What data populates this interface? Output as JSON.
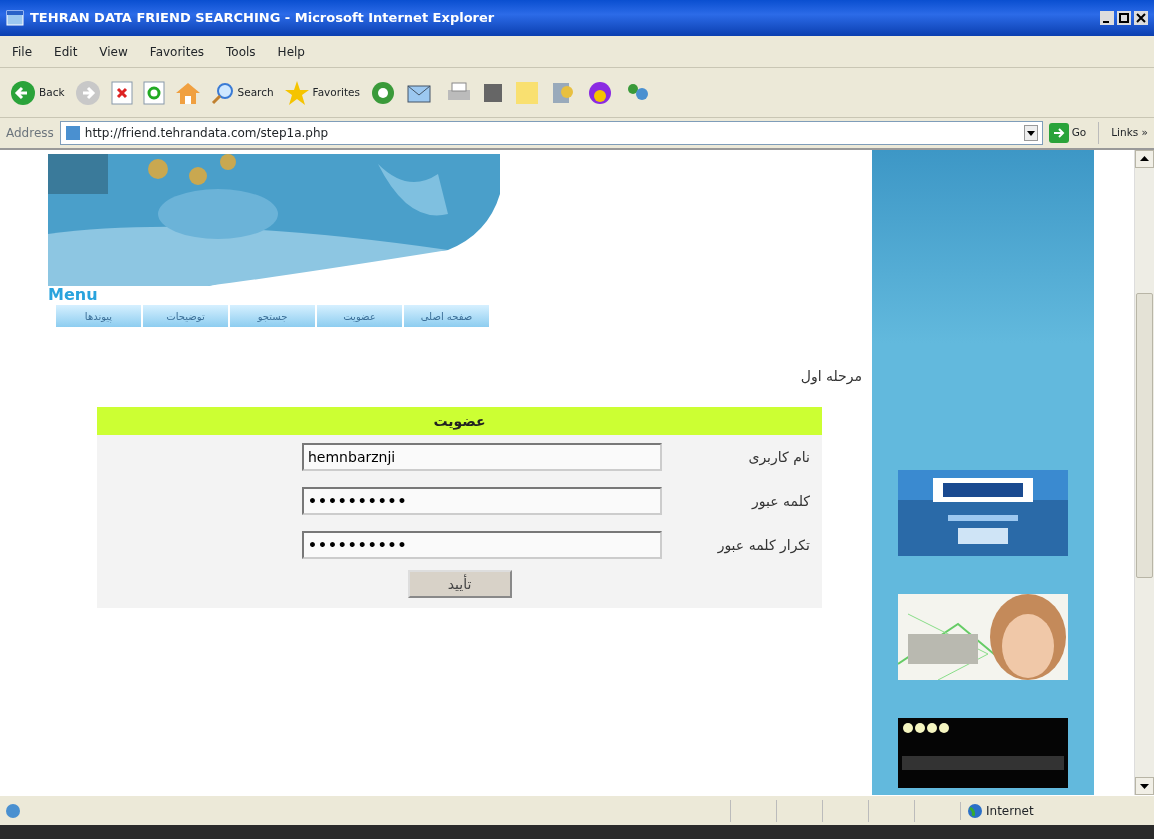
{
  "window": {
    "title": "TEHRAN DATA FRIEND SEARCHING - Microsoft Internet Explorer"
  },
  "menu_bar": {
    "file": "File",
    "edit": "Edit",
    "view": "View",
    "favorites": "Favorites",
    "tools": "Tools",
    "help": "Help"
  },
  "toolbar": {
    "back": "Back",
    "search": "Search",
    "favorites": "Favorites"
  },
  "address_bar": {
    "label": "Address",
    "url": "http://friend.tehrandata.com/step1a.php",
    "go": "Go",
    "links": "Links »"
  },
  "page": {
    "menu_title": "Menu",
    "menu_items": [
      "صفحه اصلی",
      "عضویت",
      "جستجو",
      "توضیحات",
      "پیوندها"
    ],
    "step": "مرحله اول",
    "form": {
      "title": "عضویت",
      "fields": [
        {
          "label": "نام کاربری",
          "kind": "text",
          "value": "hemnbarznji"
        },
        {
          "label": "کلمه عبور",
          "kind": "password",
          "value": "••••••••••"
        },
        {
          "label": "تکرار کلمه عبور",
          "kind": "password",
          "value": "••••••••••"
        }
      ],
      "submit": "تأیید"
    }
  },
  "status_bar": {
    "zone": "Internet"
  }
}
